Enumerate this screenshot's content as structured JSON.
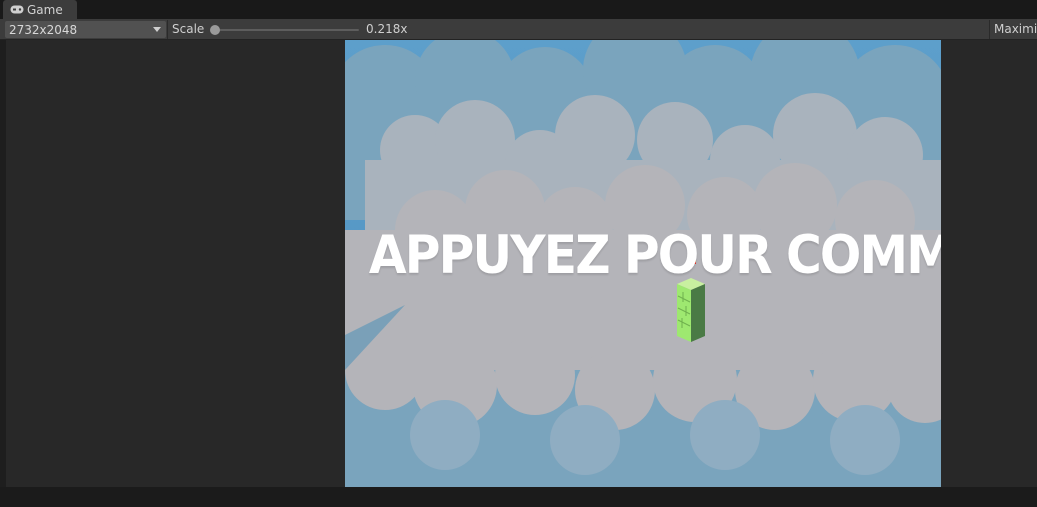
{
  "tab": {
    "label": "Game",
    "icon": "gamepad-icon"
  },
  "toolbar": {
    "resolution": "2732x2048",
    "scale_label": "Scale",
    "scale_value": "0.218x",
    "scale_fraction": 0.02,
    "maximize_label": "Maximize"
  },
  "game": {
    "prompt": "APPUYEZ POUR COMMENCER",
    "sky_color": "#5a9cc8",
    "cloud_color": "#b4b4b9",
    "tower_color": "#9ee870"
  }
}
